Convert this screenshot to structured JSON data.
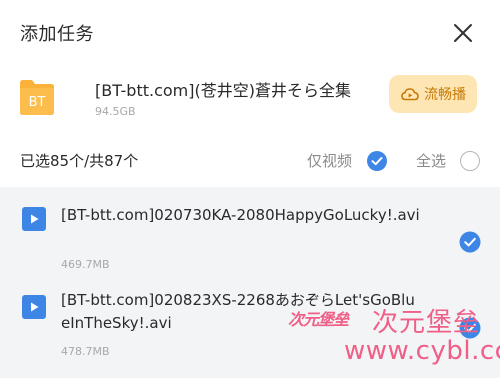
{
  "dialog": {
    "title": "添加任务",
    "task_name": "[BT-btt.com](苍井空)蒼井そら全集",
    "task_size": "94.5GB",
    "folder_label": "BT",
    "stream_button": "流畅播"
  },
  "selection": {
    "count_text": "已选85个/共87个",
    "video_only_label": "仅视频",
    "video_only_checked": true,
    "select_all_label": "全选",
    "select_all_checked": false
  },
  "files": [
    {
      "name": "[BT-btt.com]020730KA-2080HappyGoLucky!.avi",
      "size": "469.7MB",
      "checked": true
    },
    {
      "name": "[BT-btt.com]020823XS-2268あおぞらLet'sGoBlueInTheSky!.avi",
      "size": "478.7MB",
      "checked": true
    }
  ],
  "watermark": {
    "logo_text": "次元堡垒",
    "cn_text": "次元堡垒",
    "url": "www.cybl.cc"
  },
  "colors": {
    "accent": "#3e86e6",
    "stream_bg": "#fde6b3",
    "stream_text": "#c97a07",
    "watermark": "#ef5f87"
  }
}
